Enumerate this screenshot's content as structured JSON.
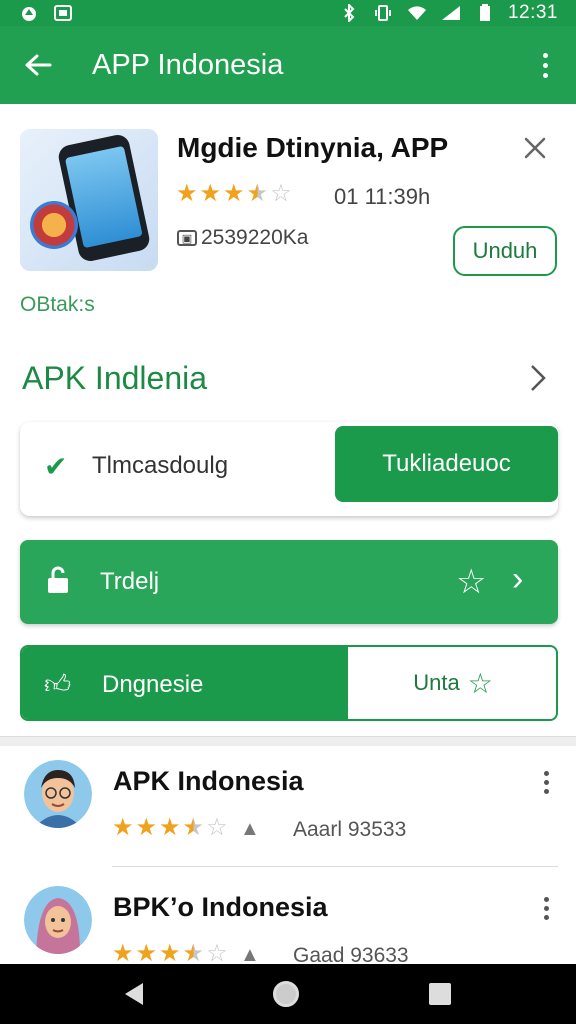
{
  "status_bar": {
    "time": "12:31",
    "icons": [
      "notification-icon",
      "image-icon",
      "bluetooth-icon",
      "vibrate-icon",
      "wifi-icon",
      "signal-icon",
      "battery-icon"
    ]
  },
  "app_bar": {
    "title": "APP Indonesia",
    "back_icon": "arrow-left-icon",
    "menu_icon": "more-vert-icon"
  },
  "app_card": {
    "name": "Mgdie Dtinynia, APP",
    "rating": 3.5,
    "version": "01  11:39h",
    "downloads": "2539220Ka",
    "download_button": "Unduh",
    "tag": "OBtak:s",
    "close_icon": "close-icon"
  },
  "section": {
    "title": "APK Indlenia",
    "chevron_icon": "chevron-right-icon"
  },
  "row1": {
    "check_label": "Tlmcasdoulg",
    "primary_button": "Tukliadeuoc"
  },
  "row2": {
    "label": "Trdelj"
  },
  "row3": {
    "left_label": "Dngnesie",
    "right_label": "Unta"
  },
  "list": [
    {
      "title": "APK Indonesia",
      "rating": 3.5,
      "meta": "Aaarl 93533"
    },
    {
      "title": "BPK’o Indonesia",
      "rating": 3.5,
      "meta": "Gaad 93633"
    }
  ],
  "colors": {
    "primary": "#1c9a4c",
    "star": "#f0a21c"
  }
}
